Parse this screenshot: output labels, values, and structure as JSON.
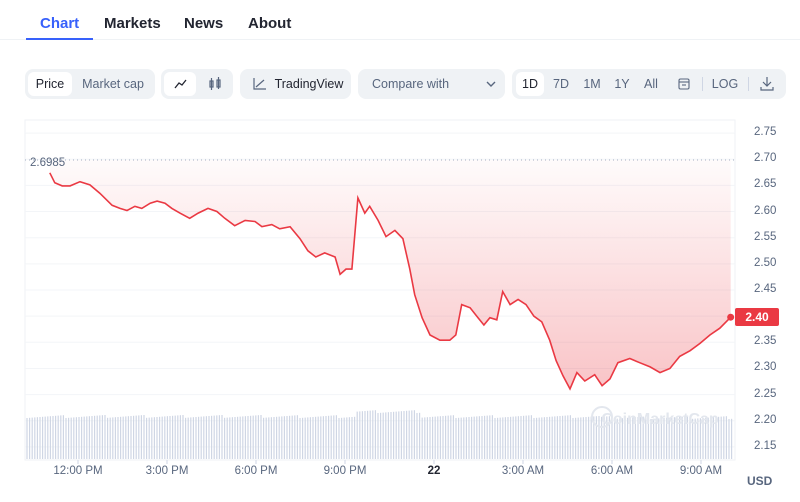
{
  "tabs": [
    "Chart",
    "Markets",
    "News",
    "About"
  ],
  "toolbar": {
    "price": "Price",
    "market_cap": "Market cap",
    "line_icon": "line-chart-icon",
    "candle_icon": "candlestick-icon",
    "tradingview": "TradingView",
    "compare": "Compare with",
    "ranges": [
      "1D",
      "7D",
      "1M",
      "1Y",
      "All"
    ],
    "calendar_icon": "calendar-icon",
    "log": "LOG",
    "download_icon": "download-icon"
  },
  "chart_data": {
    "type": "line",
    "currency": "USD",
    "open_label": "2.6985",
    "current_label": "2.40",
    "ylim": [
      2.125,
      2.775
    ],
    "yticks": [
      "2.75",
      "2.70",
      "2.65",
      "2.60",
      "2.55",
      "2.50",
      "2.45",
      "2.40",
      "2.35",
      "2.30",
      "2.25",
      "2.20",
      "2.15"
    ],
    "xticks": [
      "12:00 PM",
      "3:00 PM",
      "6:00 PM",
      "9:00 PM",
      "22",
      "3:00 AM",
      "6:00 AM",
      "9:00 AM"
    ],
    "line_color": "#ea3943",
    "watermark": "CoinMarketCap",
    "points": [
      [
        "21 11:03",
        2.674
      ],
      [
        "21 11:13",
        2.655
      ],
      [
        "21 11:28",
        2.649
      ],
      [
        "21 11:44",
        2.649
      ],
      [
        "21 12:04",
        2.657
      ],
      [
        "21 12:24",
        2.651
      ],
      [
        "21 12:44",
        2.635
      ],
      [
        "21 13:09",
        2.612
      ],
      [
        "21 13:25",
        2.606
      ],
      [
        "21 13:39",
        2.602
      ],
      [
        "21 13:55",
        2.61
      ],
      [
        "21 14:09",
        2.606
      ],
      [
        "21 14:26",
        2.616
      ],
      [
        "21 14:40",
        2.62
      ],
      [
        "21 14:56",
        2.616
      ],
      [
        "21 15:10",
        2.606
      ],
      [
        "21 15:26",
        2.597
      ],
      [
        "21 15:46",
        2.587
      ],
      [
        "21 16:03",
        2.597
      ],
      [
        "21 16:23",
        2.606
      ],
      [
        "21 16:41",
        2.6
      ],
      [
        "21 16:57",
        2.587
      ],
      [
        "21 17:17",
        2.573
      ],
      [
        "21 17:38",
        2.583
      ],
      [
        "21 17:58",
        2.581
      ],
      [
        "21 18:12",
        2.571
      ],
      [
        "21 18:32",
        2.575
      ],
      [
        "21 18:48",
        2.567
      ],
      [
        "21 19:09",
        2.571
      ],
      [
        "21 19:29",
        2.548
      ],
      [
        "21 19:45",
        2.525
      ],
      [
        "21 20:01",
        2.513
      ],
      [
        "21 20:19",
        2.521
      ],
      [
        "21 20:40",
        2.513
      ],
      [
        "21 20:50",
        2.48
      ],
      [
        "21 21:02",
        2.49
      ],
      [
        "21 21:14",
        2.49
      ],
      [
        "21 21:26",
        2.626
      ],
      [
        "21 21:40",
        2.597
      ],
      [
        "21 21:50",
        2.61
      ],
      [
        "21 22:07",
        2.583
      ],
      [
        "21 22:23",
        2.552
      ],
      [
        "21 22:41",
        2.564
      ],
      [
        "21 22:57",
        2.548
      ],
      [
        "21 23:11",
        2.49
      ],
      [
        "21 23:21",
        2.441
      ],
      [
        "21 23:36",
        2.397
      ],
      [
        "21 23:52",
        2.364
      ],
      [
        "22 00:12",
        2.354
      ],
      [
        "22 00:32",
        2.354
      ],
      [
        "22 00:44",
        2.364
      ],
      [
        "22 00:56",
        2.422
      ],
      [
        "22 01:13",
        2.416
      ],
      [
        "22 01:29",
        2.397
      ],
      [
        "22 01:41",
        2.383
      ],
      [
        "22 01:53",
        2.397
      ],
      [
        "22 02:07",
        2.393
      ],
      [
        "22 02:19",
        2.447
      ],
      [
        "22 02:34",
        2.422
      ],
      [
        "22 02:50",
        2.432
      ],
      [
        "22 03:06",
        2.422
      ],
      [
        "22 03:22",
        2.4
      ],
      [
        "22 03:38",
        2.389
      ],
      [
        "22 03:54",
        2.354
      ],
      [
        "22 04:07",
        2.315
      ],
      [
        "22 04:21",
        2.286
      ],
      [
        "22 04:35",
        2.261
      ],
      [
        "22 04:49",
        2.292
      ],
      [
        "22 05:05",
        2.276
      ],
      [
        "22 05:25",
        2.288
      ],
      [
        "22 05:40",
        2.267
      ],
      [
        "22 05:56",
        2.28
      ],
      [
        "22 06:12",
        2.311
      ],
      [
        "22 06:36",
        2.319
      ],
      [
        "22 06:56",
        2.311
      ],
      [
        "22 07:17",
        2.303
      ],
      [
        "22 07:37",
        2.292
      ],
      [
        "22 07:57",
        2.3
      ],
      [
        "22 08:17",
        2.323
      ],
      [
        "22 08:38",
        2.334
      ],
      [
        "22 08:58",
        2.348
      ],
      [
        "22 09:18",
        2.364
      ],
      [
        "22 09:38",
        2.377
      ],
      [
        "22 10:00",
        2.398
      ]
    ]
  }
}
